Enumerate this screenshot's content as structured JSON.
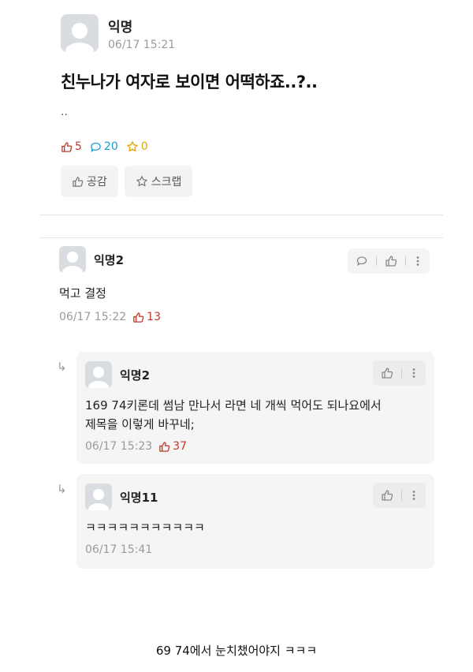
{
  "post": {
    "author": "익명",
    "time": "06/17 15:21",
    "title": "친누나가 여자로 보이면 어떡하죠..?..",
    "body": "..",
    "stats": {
      "likes": "5",
      "comments": "20",
      "scraps": "0"
    },
    "actions": {
      "like_label": "공감",
      "scrap_label": "스크랩"
    }
  },
  "comments": [
    {
      "author": "익명2",
      "text": "먹고 결정",
      "time": "06/17 15:22",
      "likes": "13"
    }
  ],
  "replies": [
    {
      "author": "익명2",
      "text": "169 74키론데 썸남 만나서 라면 네 개씩 먹어도 되나요에서 제목을 이렇게 바꾸네;",
      "time": "06/17 15:23",
      "likes": "37"
    },
    {
      "author": "익명11",
      "text": "ㅋㅋㅋㅋㅋㅋㅋㅋㅋㅋㅋ",
      "time": "06/17 15:41"
    }
  ],
  "reply_arrow": "↳",
  "caption": "69 74에서 눈치챘어야지 ㅋㅋㅋ",
  "colors": {
    "like": "#c0392b",
    "comment": "#1a9bd7",
    "scrap": "#e0a800"
  }
}
